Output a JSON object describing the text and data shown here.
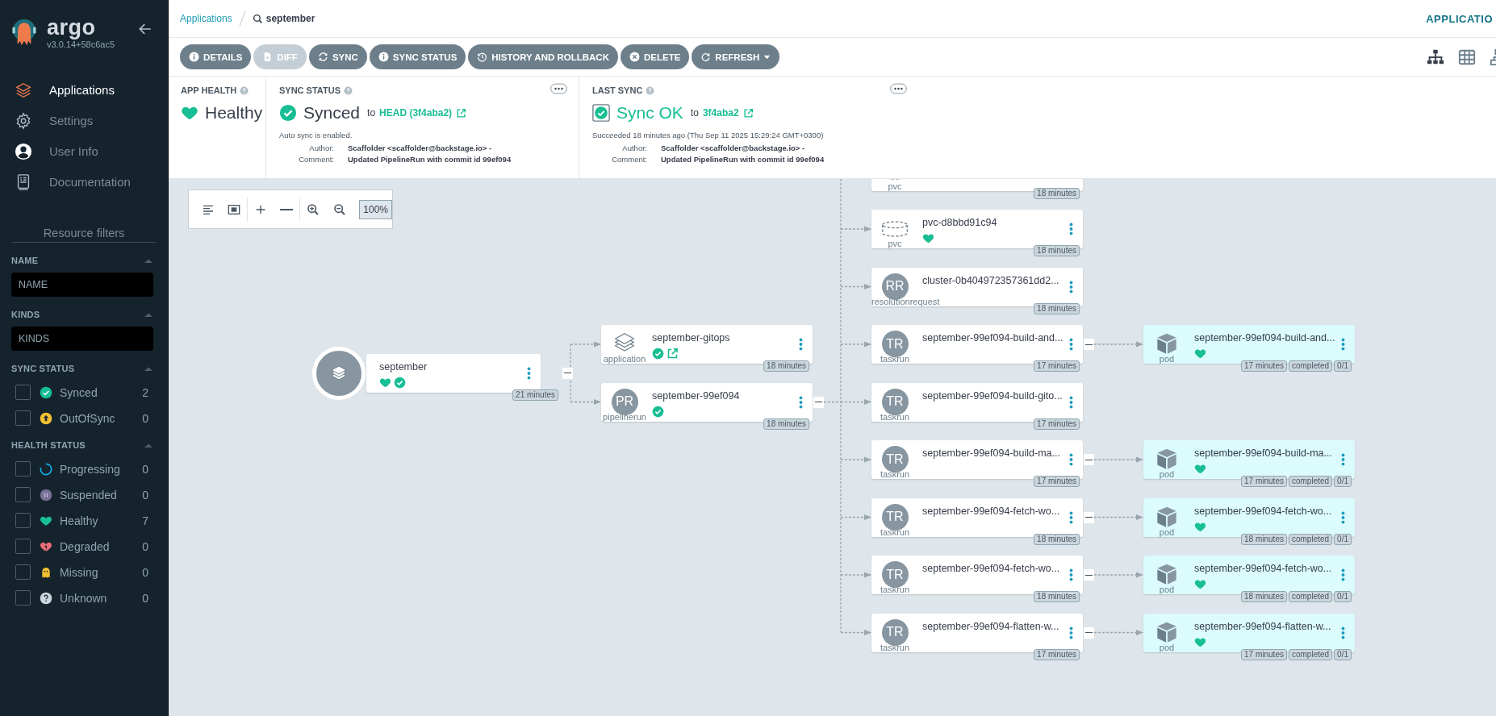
{
  "sidebar": {
    "logo": "argo",
    "version": "v3.0.14+58c6ac5",
    "nav": [
      {
        "label": "Applications",
        "selected": true
      },
      {
        "label": "Settings",
        "selected": false
      },
      {
        "label": "User Info",
        "selected": false
      },
      {
        "label": "Documentation",
        "selected": false
      }
    ],
    "filters_title": "Resource filters",
    "sections": [
      {
        "title": "NAME",
        "kind": "field",
        "placeholder": "NAME"
      },
      {
        "title": "KINDS",
        "kind": "field",
        "placeholder": "KINDS"
      },
      {
        "title": "SYNC STATUS",
        "kind": "checklist",
        "items": [
          {
            "label": "Synced",
            "kind": "synced",
            "count": "2",
            "checked": false
          },
          {
            "label": "OutOfSync",
            "kind": "outofsync",
            "count": "0",
            "checked": false
          }
        ]
      },
      {
        "title": "HEALTH STATUS",
        "kind": "checklist",
        "items": [
          {
            "label": "Progressing",
            "kind": "progressing",
            "count": "0",
            "checked": false
          },
          {
            "label": "Suspended",
            "kind": "suspended",
            "count": "0",
            "checked": false
          },
          {
            "label": "Healthy",
            "kind": "healthy",
            "count": "7",
            "checked": false
          },
          {
            "label": "Degraded",
            "kind": "degraded",
            "count": "0",
            "checked": false
          },
          {
            "label": "Missing",
            "kind": "missing",
            "count": "0",
            "checked": false
          },
          {
            "label": "Unknown",
            "kind": "unknown",
            "count": "0",
            "checked": false
          }
        ]
      }
    ]
  },
  "breadcrumb": {
    "link": "Applications",
    "search": "september",
    "right": "APPLICATIO"
  },
  "toolbar": {
    "buttons": [
      {
        "label": "DETAILS",
        "disabled": false
      },
      {
        "label": "DIFF",
        "disabled": true
      },
      {
        "label": "SYNC",
        "disabled": false
      },
      {
        "label": "SYNC STATUS",
        "disabled": false
      },
      {
        "label": "HISTORY AND ROLLBACK",
        "disabled": false
      },
      {
        "label": "DELETE",
        "disabled": false
      },
      {
        "label": "REFRESH",
        "disabled": false,
        "dropdown": true
      }
    ],
    "views": [
      {
        "kind": "tree",
        "selected": true
      },
      {
        "kind": "grid",
        "selected": false
      },
      {
        "kind": "network",
        "selected": false
      }
    ]
  },
  "app_health": {
    "title": "APP HEALTH",
    "status": "Healthy",
    "healthy": true
  },
  "sync_status": {
    "title": "SYNC STATUS",
    "status": "Synced",
    "synced": true,
    "to": "to",
    "revision": "HEAD (3f4aba2)",
    "note": "Auto sync is enabled.",
    "details": [
      {
        "label": "Author:",
        "value": "Scaffolder <scaffolder@backstage.io> -"
      },
      {
        "label": "Comment:",
        "value": "Updated PipelineRun with commit id 99ef094"
      }
    ]
  },
  "last_sync": {
    "title": "LAST SYNC",
    "status": "Sync OK",
    "succeeded": true,
    "to": "to",
    "revision": "3f4aba2",
    "note": "Succeeded 18 minutes ago (Thu Sep 11 2025 15:29:24 GMT+0300)",
    "details": [
      {
        "label": "Author:",
        "value": "Scaffolder <scaffolder@backstage.io> -"
      },
      {
        "label": "Comment:",
        "value": "Updated PipelineRun with commit id 99ef094"
      }
    ]
  },
  "graph": {
    "zoom": "100%",
    "root": {
      "kind": "application",
      "name": "september",
      "healthy": true,
      "synced": true,
      "badges": [
        "21 minutes"
      ],
      "children": [
        {
          "kind": "application",
          "type_label": "application",
          "name": "september-gitops",
          "synced": true,
          "link": true,
          "badges": [
            "18 minutes"
          ]
        },
        {
          "kind": "pipelinerun",
          "icon_text": "PR",
          "type_label": "pipelinerun",
          "name": "september-99ef094",
          "synced": true,
          "badges": [
            "18 minutes"
          ],
          "children": [
            {
              "kind": "pvc",
              "type_label": "pvc",
              "badges": [
                "18 minutes"
              ]
            },
            {
              "kind": "pvc",
              "type_label": "pvc",
              "name": "pvc-d8bbd91c94",
              "healthy": true,
              "badges": [
                "18 minutes"
              ]
            },
            {
              "kind": "resolutionrequest",
              "icon_text": "RR",
              "type_label": "resolutionrequest",
              "name": "cluster-0b404972357361dd2...",
              "badges": [
                "18 minutes"
              ]
            },
            {
              "kind": "taskrun",
              "icon_text": "TR",
              "type_label": "taskrun",
              "name": "september-99ef094-build-and...",
              "badges": [
                "17 minutes"
              ],
              "children": [
                {
                  "kind": "pod",
                  "type_label": "pod",
                  "name": "september-99ef094-build-and...",
                  "healthy": true,
                  "badges": [
                    "17 minutes",
                    "completed",
                    "0/1"
                  ]
                }
              ]
            },
            {
              "kind": "taskrun",
              "icon_text": "TR",
              "type_label": "taskrun",
              "name": "september-99ef094-build-gito...",
              "badges": [
                "17 minutes"
              ]
            },
            {
              "kind": "taskrun",
              "icon_text": "TR",
              "type_label": "taskrun",
              "name": "september-99ef094-build-ma...",
              "badges": [
                "17 minutes"
              ],
              "children": [
                {
                  "kind": "pod",
                  "type_label": "pod",
                  "name": "september-99ef094-build-ma...",
                  "healthy": true,
                  "badges": [
                    "17 minutes",
                    "completed",
                    "0/1"
                  ]
                }
              ]
            },
            {
              "kind": "taskrun",
              "icon_text": "TR",
              "type_label": "taskrun",
              "name": "september-99ef094-fetch-wo...",
              "badges": [
                "18 minutes"
              ],
              "children": [
                {
                  "kind": "pod",
                  "type_label": "pod",
                  "name": "september-99ef094-fetch-wo...",
                  "healthy": true,
                  "badges": [
                    "18 minutes",
                    "completed",
                    "0/1"
                  ]
                }
              ]
            },
            {
              "kind": "taskrun",
              "icon_text": "TR",
              "type_label": "taskrun",
              "name": "september-99ef094-fetch-wo...",
              "badges": [
                "18 minutes"
              ],
              "children": [
                {
                  "kind": "pod",
                  "type_label": "pod",
                  "name": "september-99ef094-fetch-wo...",
                  "healthy": true,
                  "badges": [
                    "18 minutes",
                    "completed",
                    "0/1"
                  ]
                }
              ]
            },
            {
              "kind": "taskrun",
              "icon_text": "TR",
              "type_label": "taskrun",
              "name": "september-99ef094-flatten-w...",
              "badges": [
                "17 minutes"
              ],
              "children": [
                {
                  "kind": "pod",
                  "type_label": "pod",
                  "name": "september-99ef094-flatten-w...",
                  "healthy": true,
                  "badges": [
                    "17 minutes",
                    "completed",
                    "0/1"
                  ]
                }
              ]
            }
          ]
        }
      ]
    }
  }
}
